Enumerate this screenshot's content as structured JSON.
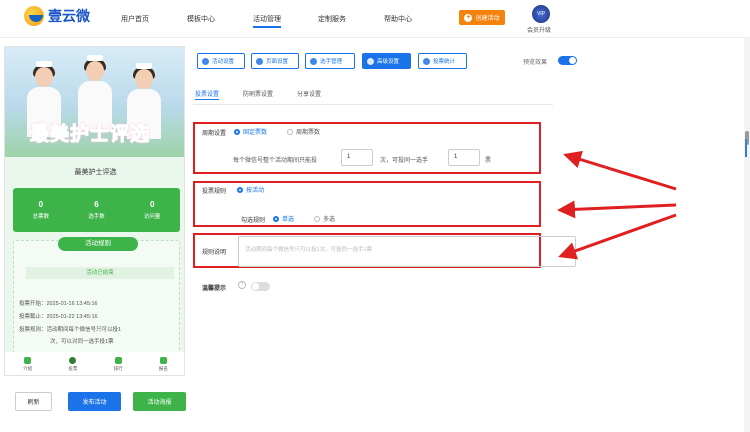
{
  "header": {
    "brand": "壹云微",
    "nav": [
      "用户首页",
      "模板中心",
      "活动管理",
      "定制服务",
      "帮助中心"
    ],
    "create_label": "创建活动",
    "vip_badge": "VIP",
    "vip_label": "会员升级"
  },
  "preview": {
    "banner_title": "最美护士评选",
    "activity_title": "最美护士评选",
    "stats": [
      {
        "value": "0",
        "label": "总票数"
      },
      {
        "value": "6",
        "label": "选手数"
      },
      {
        "value": "0",
        "label": "访问量"
      }
    ],
    "rules_title": "活动规则",
    "rules_status": "活动已结束",
    "rules": [
      "投票开始：2025-01-16 13:45:16",
      "投票截止：2025-01-22 13:45:16",
      "投票规则：活动期间每个微信号只可以投1",
      "次，可以对同一选手投1票"
    ],
    "tabs": [
      "介绍",
      "投票",
      "排行",
      "报名"
    ]
  },
  "actions": {
    "refresh": "刷新",
    "publish": "发布活动",
    "poster": "活动海报"
  },
  "toolbar": {
    "buttons": [
      "活动设置",
      "页面设置",
      "选手管理",
      "高级设置",
      "投票统计"
    ],
    "preview_label": "预览效果"
  },
  "subtabs": [
    "投票设置",
    "防刷票设置",
    "分享设置"
  ],
  "form": {
    "period_label": "周期设置",
    "period_fixed": "固定票数",
    "period_cycle": "周期票数",
    "limit_text_1": "每个微信号整个活动期间只能投",
    "limit_value": "1",
    "limit_text_2": "次，可投同一选手",
    "same_value": "1",
    "limit_text_3": "票",
    "rule_label": "投票规则",
    "rule_value": "按活动",
    "select_label": "勾选规则",
    "select_single": "单选",
    "select_multi": "多选",
    "desc_label": "规则说明",
    "desc_placeholder": "活动期间每个微信号只可以投1次，可投同一选手1票",
    "tip_label": "温馨提示",
    "tip_help": "?"
  }
}
